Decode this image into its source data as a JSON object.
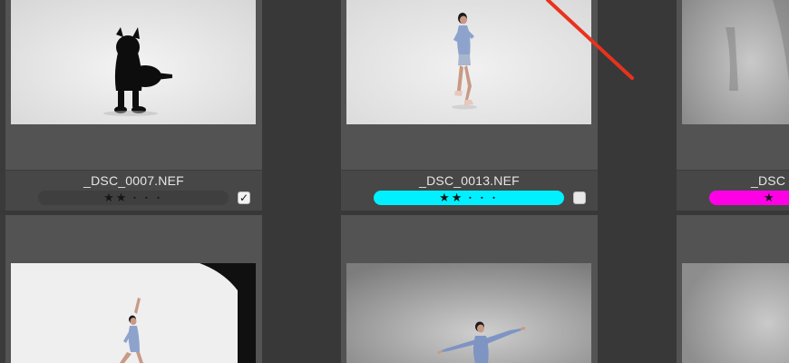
{
  "colors": {
    "background": "#3a3a3a",
    "cell": "#535353",
    "label_bar": "#474747",
    "cyan_label": "#00f0ff",
    "magenta_label": "#ff00e6",
    "gray_label": "#3f3f3f",
    "annotation_arrow": "#e8321e"
  },
  "thumbnails": [
    {
      "filename": "_DSC_0007.NEF",
      "stars": "★★",
      "empty_dots": "• • •",
      "color_label": "none",
      "checked": true,
      "check_mark": "✓",
      "subject": "black dog lying on white backdrop"
    },
    {
      "filename": "_DSC_0013.NEF",
      "stars": "★★",
      "empty_dots": "• • •",
      "color_label": "cyan",
      "checked": false,
      "check_mark": "",
      "subject": "dancer in blue leotard on white backdrop"
    },
    {
      "filename": "_DSC",
      "stars": "★",
      "empty_dots": "",
      "color_label": "magenta",
      "checked": false,
      "check_mark": "",
      "subject": "blurred motion figure on gray backdrop"
    },
    {
      "filename": "",
      "subject": "dancer posing with raised arm near black backdrop"
    },
    {
      "filename": "",
      "subject": "dancer with outstretched arms on gray backdrop"
    },
    {
      "filename": "",
      "subject": "gray backdrop partial"
    }
  ]
}
